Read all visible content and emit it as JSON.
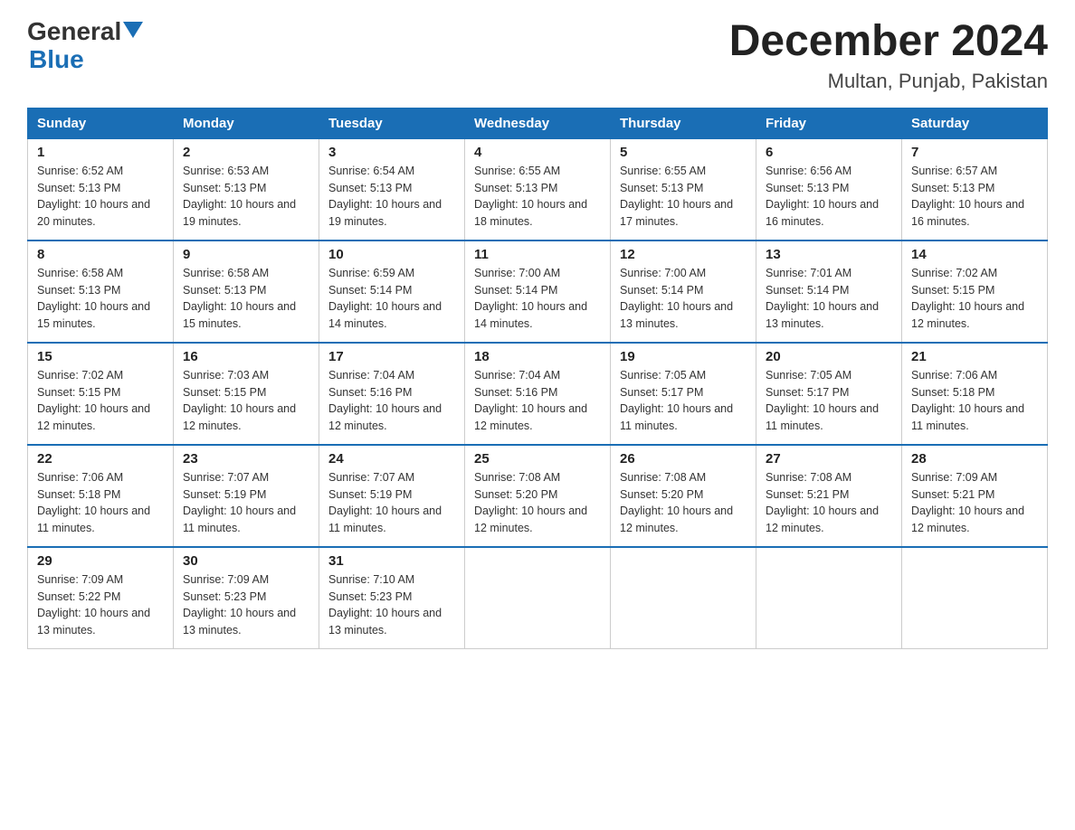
{
  "logo": {
    "general": "General",
    "arrow": "▲",
    "blue": "Blue"
  },
  "title": "December 2024",
  "subtitle": "Multan, Punjab, Pakistan",
  "days_of_week": [
    "Sunday",
    "Monday",
    "Tuesday",
    "Wednesday",
    "Thursday",
    "Friday",
    "Saturday"
  ],
  "weeks": [
    [
      {
        "day": "1",
        "sunrise": "6:52 AM",
        "sunset": "5:13 PM",
        "daylight": "10 hours and 20 minutes."
      },
      {
        "day": "2",
        "sunrise": "6:53 AM",
        "sunset": "5:13 PM",
        "daylight": "10 hours and 19 minutes."
      },
      {
        "day": "3",
        "sunrise": "6:54 AM",
        "sunset": "5:13 PM",
        "daylight": "10 hours and 19 minutes."
      },
      {
        "day": "4",
        "sunrise": "6:55 AM",
        "sunset": "5:13 PM",
        "daylight": "10 hours and 18 minutes."
      },
      {
        "day": "5",
        "sunrise": "6:55 AM",
        "sunset": "5:13 PM",
        "daylight": "10 hours and 17 minutes."
      },
      {
        "day": "6",
        "sunrise": "6:56 AM",
        "sunset": "5:13 PM",
        "daylight": "10 hours and 16 minutes."
      },
      {
        "day": "7",
        "sunrise": "6:57 AM",
        "sunset": "5:13 PM",
        "daylight": "10 hours and 16 minutes."
      }
    ],
    [
      {
        "day": "8",
        "sunrise": "6:58 AM",
        "sunset": "5:13 PM",
        "daylight": "10 hours and 15 minutes."
      },
      {
        "day": "9",
        "sunrise": "6:58 AM",
        "sunset": "5:13 PM",
        "daylight": "10 hours and 15 minutes."
      },
      {
        "day": "10",
        "sunrise": "6:59 AM",
        "sunset": "5:14 PM",
        "daylight": "10 hours and 14 minutes."
      },
      {
        "day": "11",
        "sunrise": "7:00 AM",
        "sunset": "5:14 PM",
        "daylight": "10 hours and 14 minutes."
      },
      {
        "day": "12",
        "sunrise": "7:00 AM",
        "sunset": "5:14 PM",
        "daylight": "10 hours and 13 minutes."
      },
      {
        "day": "13",
        "sunrise": "7:01 AM",
        "sunset": "5:14 PM",
        "daylight": "10 hours and 13 minutes."
      },
      {
        "day": "14",
        "sunrise": "7:02 AM",
        "sunset": "5:15 PM",
        "daylight": "10 hours and 12 minutes."
      }
    ],
    [
      {
        "day": "15",
        "sunrise": "7:02 AM",
        "sunset": "5:15 PM",
        "daylight": "10 hours and 12 minutes."
      },
      {
        "day": "16",
        "sunrise": "7:03 AM",
        "sunset": "5:15 PM",
        "daylight": "10 hours and 12 minutes."
      },
      {
        "day": "17",
        "sunrise": "7:04 AM",
        "sunset": "5:16 PM",
        "daylight": "10 hours and 12 minutes."
      },
      {
        "day": "18",
        "sunrise": "7:04 AM",
        "sunset": "5:16 PM",
        "daylight": "10 hours and 12 minutes."
      },
      {
        "day": "19",
        "sunrise": "7:05 AM",
        "sunset": "5:17 PM",
        "daylight": "10 hours and 11 minutes."
      },
      {
        "day": "20",
        "sunrise": "7:05 AM",
        "sunset": "5:17 PM",
        "daylight": "10 hours and 11 minutes."
      },
      {
        "day": "21",
        "sunrise": "7:06 AM",
        "sunset": "5:18 PM",
        "daylight": "10 hours and 11 minutes."
      }
    ],
    [
      {
        "day": "22",
        "sunrise": "7:06 AM",
        "sunset": "5:18 PM",
        "daylight": "10 hours and 11 minutes."
      },
      {
        "day": "23",
        "sunrise": "7:07 AM",
        "sunset": "5:19 PM",
        "daylight": "10 hours and 11 minutes."
      },
      {
        "day": "24",
        "sunrise": "7:07 AM",
        "sunset": "5:19 PM",
        "daylight": "10 hours and 11 minutes."
      },
      {
        "day": "25",
        "sunrise": "7:08 AM",
        "sunset": "5:20 PM",
        "daylight": "10 hours and 12 minutes."
      },
      {
        "day": "26",
        "sunrise": "7:08 AM",
        "sunset": "5:20 PM",
        "daylight": "10 hours and 12 minutes."
      },
      {
        "day": "27",
        "sunrise": "7:08 AM",
        "sunset": "5:21 PM",
        "daylight": "10 hours and 12 minutes."
      },
      {
        "day": "28",
        "sunrise": "7:09 AM",
        "sunset": "5:21 PM",
        "daylight": "10 hours and 12 minutes."
      }
    ],
    [
      {
        "day": "29",
        "sunrise": "7:09 AM",
        "sunset": "5:22 PM",
        "daylight": "10 hours and 13 minutes."
      },
      {
        "day": "30",
        "sunrise": "7:09 AM",
        "sunset": "5:23 PM",
        "daylight": "10 hours and 13 minutes."
      },
      {
        "day": "31",
        "sunrise": "7:10 AM",
        "sunset": "5:23 PM",
        "daylight": "10 hours and 13 minutes."
      },
      null,
      null,
      null,
      null
    ]
  ]
}
